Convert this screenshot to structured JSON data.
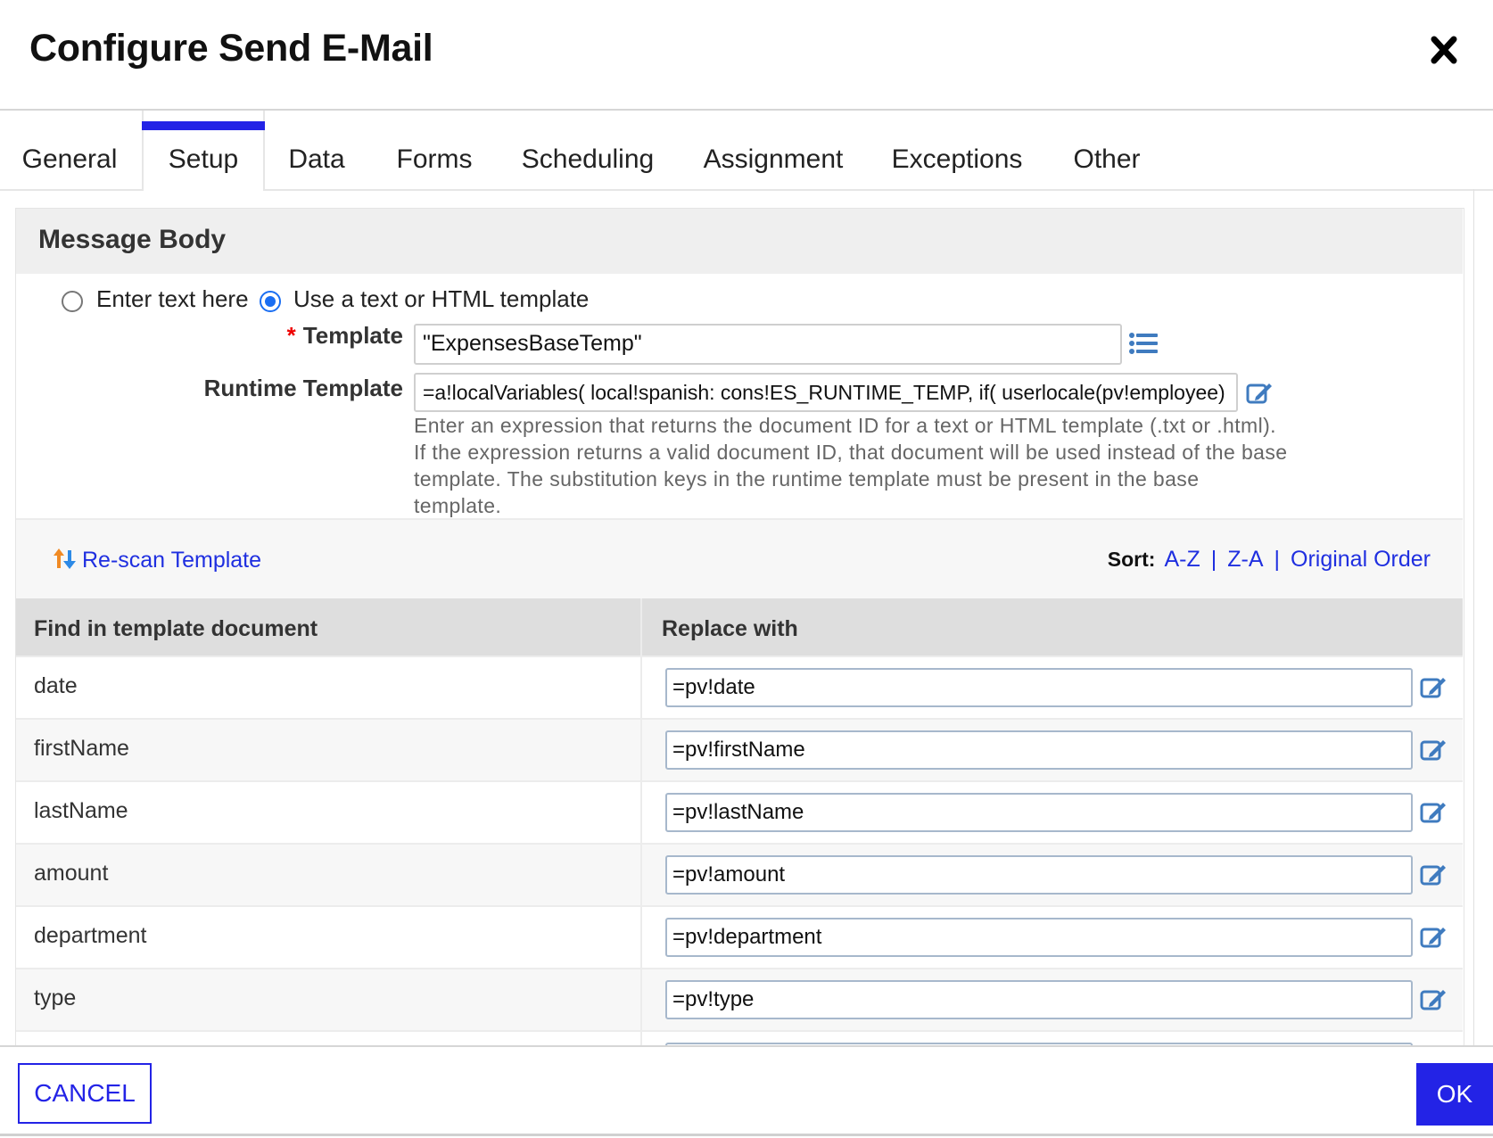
{
  "dialog": {
    "title": "Configure Send E-Mail",
    "close_icon": "close-icon"
  },
  "tabs": [
    {
      "label": "General",
      "active": false
    },
    {
      "label": "Setup",
      "active": true
    },
    {
      "label": "Data",
      "active": false
    },
    {
      "label": "Forms",
      "active": false
    },
    {
      "label": "Scheduling",
      "active": false
    },
    {
      "label": "Assignment",
      "active": false
    },
    {
      "label": "Exceptions",
      "active": false
    },
    {
      "label": "Other",
      "active": false
    }
  ],
  "message_body": {
    "section_title": "Message Body",
    "radio_options": [
      {
        "label": "Enter text here",
        "selected": false
      },
      {
        "label": "Use a text or HTML template",
        "selected": true
      }
    ],
    "template": {
      "required_marker": "*",
      "label": "Template",
      "value": "\"ExpensesBaseTemp\"",
      "picker_icon": "list-icon"
    },
    "runtime_template": {
      "label": "Runtime Template",
      "value": "=a!localVariables(  local!spanish: cons!ES_RUNTIME_TEMP,  if(    userlocale(pv!employee)",
      "edit_icon": "edit-icon",
      "help_text": "Enter an expression that returns the document ID for a text or HTML template (.txt or .html). If the expression returns a valid document ID, that document will be used instead of the base template. The substitution keys in the runtime template must be present in the base template."
    }
  },
  "toolbar": {
    "rescan_label": "Re-scan Template",
    "rescan_icon": "rescan-icon",
    "sort_label": "Sort:",
    "sort_options": [
      "A-Z",
      "Z-A",
      "Original Order"
    ],
    "sort_separator": "|"
  },
  "table": {
    "columns": [
      "Find in template document",
      "Replace with"
    ],
    "rows": [
      {
        "key": "date",
        "value": "=pv!date"
      },
      {
        "key": "firstName",
        "value": "=pv!firstName"
      },
      {
        "key": "lastName",
        "value": "=pv!lastName"
      },
      {
        "key": "amount",
        "value": "=pv!amount"
      },
      {
        "key": "department",
        "value": "=pv!department"
      },
      {
        "key": "type",
        "value": "=pv!type"
      },
      {
        "key": "",
        "value": ""
      }
    ]
  },
  "footer": {
    "cancel_label": "CANCEL",
    "ok_label": "OK"
  },
  "colors": {
    "accent": "#2323e6",
    "link": "#1f2fe0",
    "radio_selected": "#1a6ef2",
    "required": "#ee0000",
    "icon_blue": "#3f7bbf"
  }
}
